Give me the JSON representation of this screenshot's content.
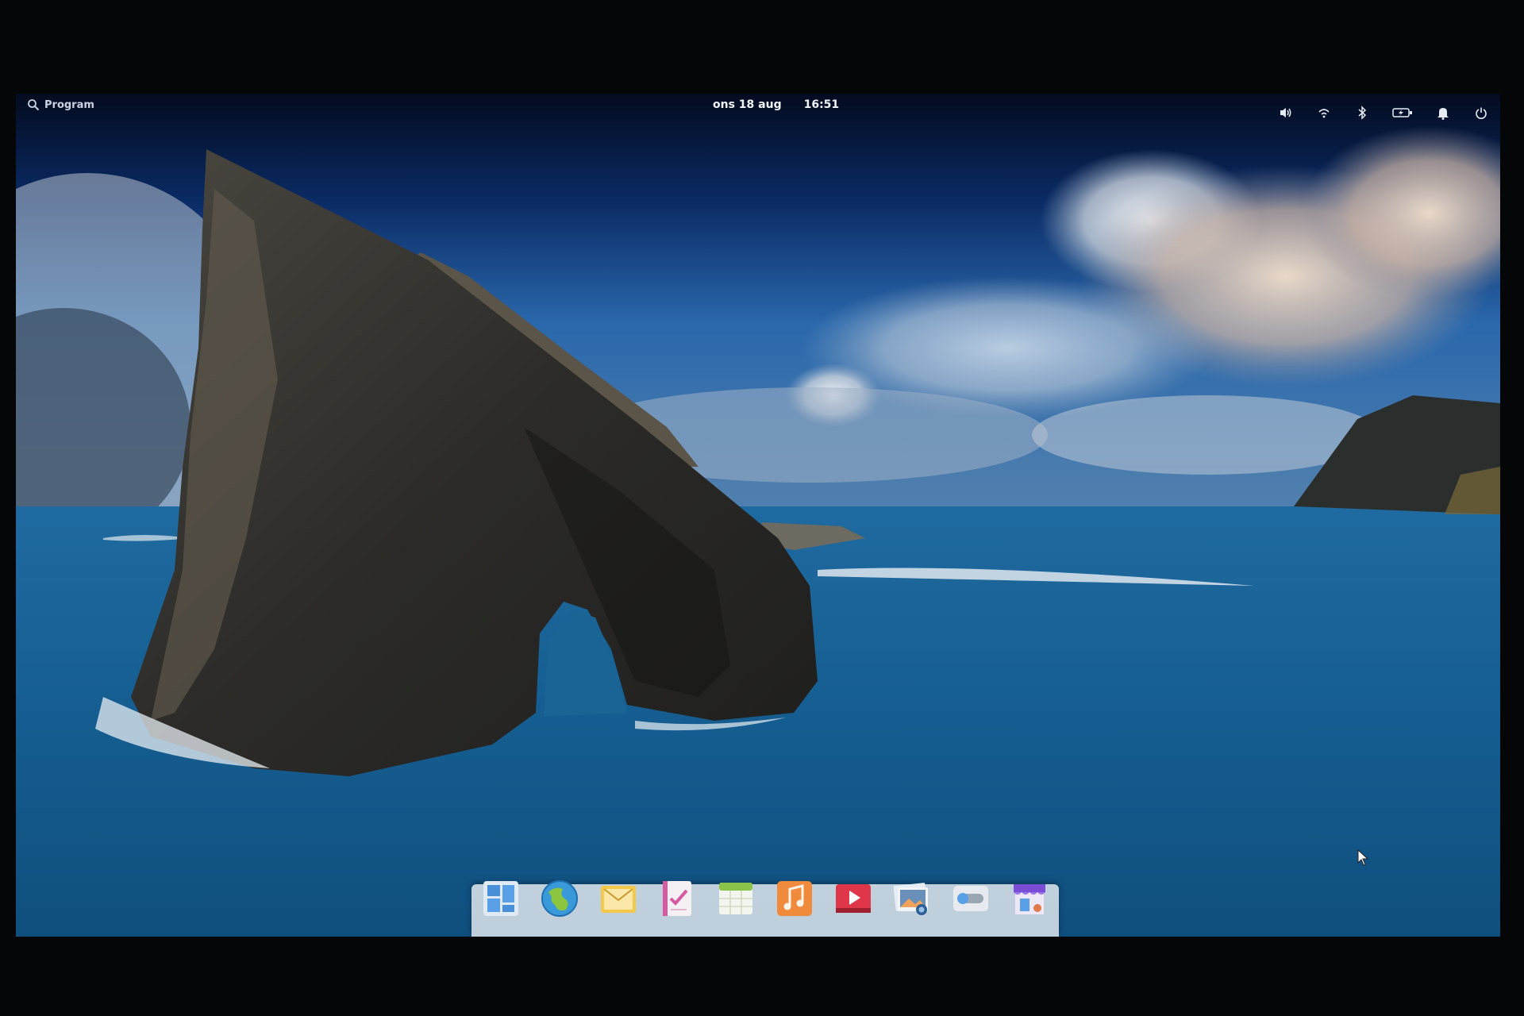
{
  "panel": {
    "applications_label": "Program",
    "date": "ons 18 aug",
    "time": "16:51",
    "indicators": [
      {
        "name": "volume-icon"
      },
      {
        "name": "network-icon"
      },
      {
        "name": "bluetooth-icon"
      },
      {
        "name": "battery-icon"
      },
      {
        "name": "notifications-icon"
      },
      {
        "name": "power-icon"
      }
    ]
  },
  "dock": {
    "apps": [
      {
        "icon": "multitasking-view-icon",
        "color": "#4a90d9"
      },
      {
        "icon": "web-browser-icon",
        "color": "#3a9ad9"
      },
      {
        "icon": "mail-icon",
        "color": "#f4c84a"
      },
      {
        "icon": "tasks-icon",
        "color": "#d65aa0"
      },
      {
        "icon": "calendar-icon",
        "color": "#8bc34a"
      },
      {
        "icon": "music-icon",
        "color": "#f08a3c"
      },
      {
        "icon": "videos-icon",
        "color": "#e0364a"
      },
      {
        "icon": "photos-icon",
        "color": "#6a8fb8"
      },
      {
        "icon": "system-settings-icon",
        "color": "#9aa6b2"
      },
      {
        "icon": "app-center-icon",
        "color": "#7b4dd6"
      }
    ]
  }
}
